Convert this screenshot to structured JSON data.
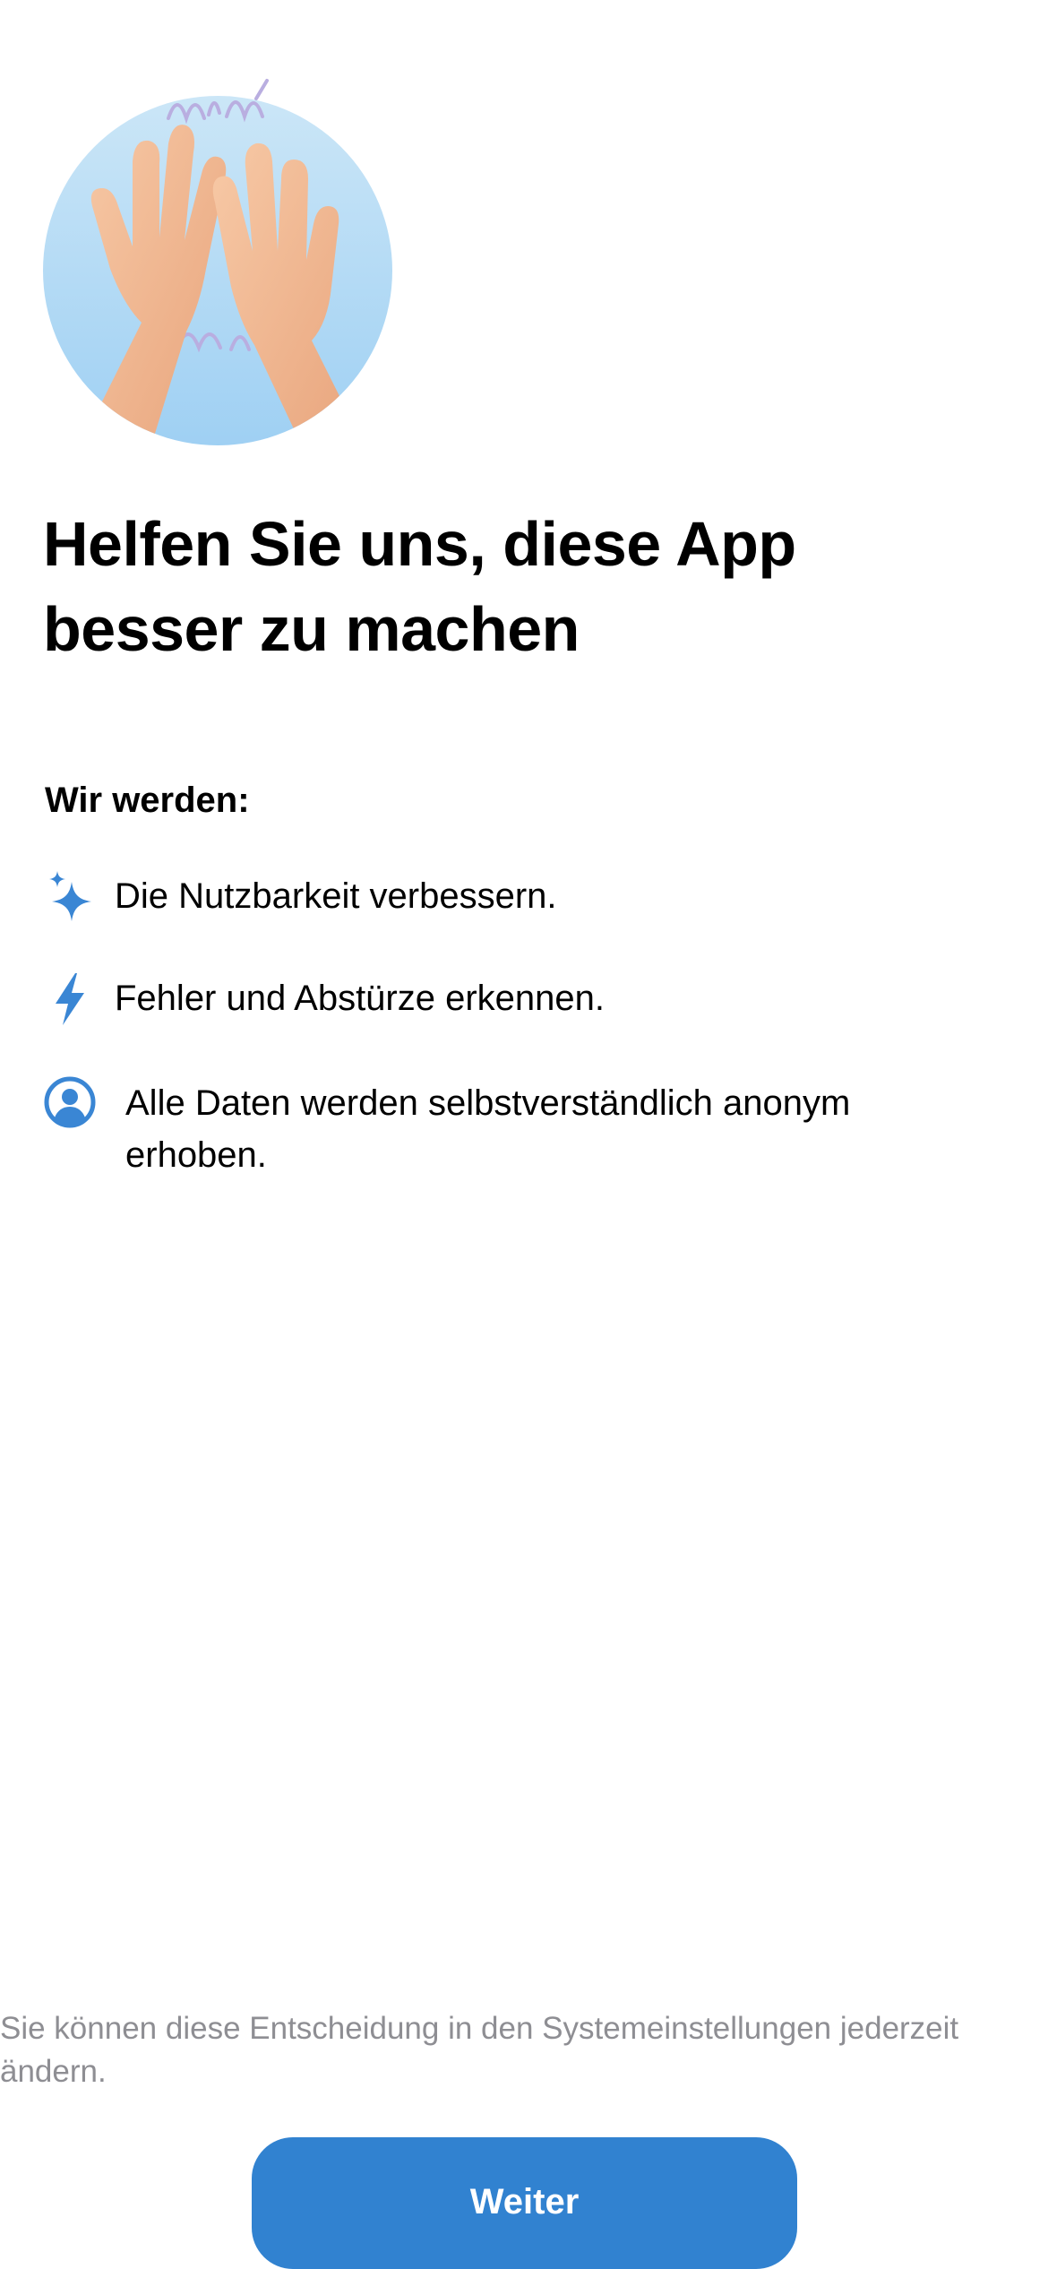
{
  "hero": {
    "icon": "high-five-hands-icon",
    "circle_color_top": "#cbe6f7",
    "circle_color_bottom": "#9fd0f3"
  },
  "title": "Helfen Sie uns, diese App besser zu machen",
  "section_heading": "Wir werden:",
  "features": [
    {
      "icon": "sparkles-icon",
      "text": "Die Nutzbarkeit verbessern."
    },
    {
      "icon": "bolt-icon",
      "text": "Fehler und Abstürze erkennen."
    },
    {
      "icon": "person-circle-icon",
      "text": "Alle Daten werden selbstverständlich anonym erhoben."
    }
  ],
  "footnote": "Sie können diese Entscheidung in den Systemeinstellungen jederzeit ändern.",
  "continue_button": {
    "label": "Weiter"
  },
  "colors": {
    "accent": "#3182d0",
    "footnote_text": "#8e8e93",
    "icon_blue": "#3a86d4"
  }
}
